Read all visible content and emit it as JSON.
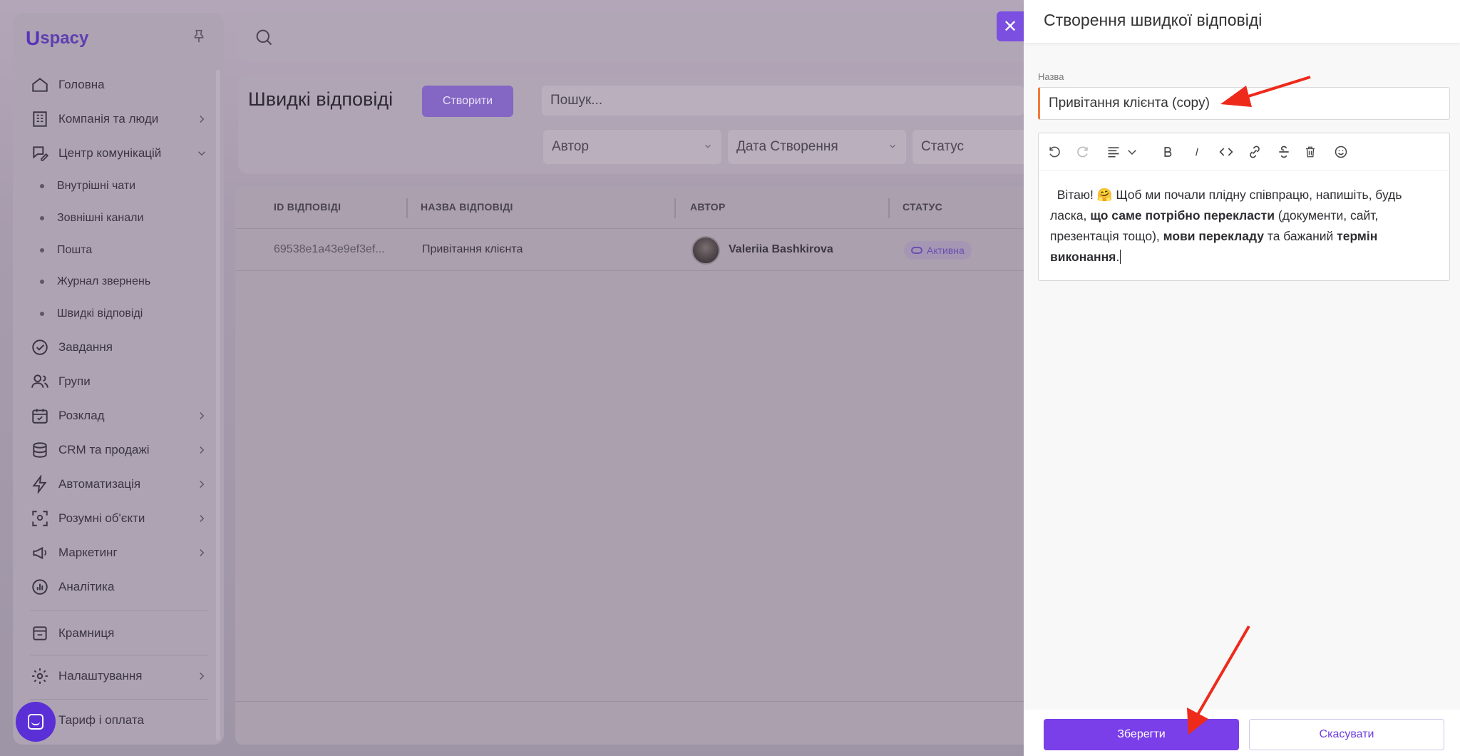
{
  "sidebar": {
    "logo": "spacy",
    "logo_u": "U",
    "items": [
      {
        "label": "Головна"
      },
      {
        "label": "Компанія та люди"
      },
      {
        "label": "Центр комунікацій"
      },
      {
        "label": "Завдання"
      },
      {
        "label": "Групи"
      },
      {
        "label": "Розклад"
      },
      {
        "label": "CRM та продажі"
      },
      {
        "label": "Автоматизація"
      },
      {
        "label": "Розумні об'єкти"
      },
      {
        "label": "Маркетинг"
      },
      {
        "label": "Аналітика"
      },
      {
        "label": "Крамниця"
      },
      {
        "label": "Налаштування"
      },
      {
        "label": "Тариф і оплата"
      }
    ],
    "sub_items": [
      {
        "label": "Внутрішні чати"
      },
      {
        "label": "Зовнішні канали"
      },
      {
        "label": "Пошта"
      },
      {
        "label": "Журнал звернень"
      },
      {
        "label": "Швидкі відповіді"
      }
    ]
  },
  "page": {
    "title": "Швидкі відповіді",
    "create_label": "Створити",
    "search_placeholder": "Пошук...",
    "filters": {
      "author": "Автор",
      "date": "Дата Створення",
      "status": "Статус"
    }
  },
  "table": {
    "headers": [
      "ID ВІДПОВІДІ",
      "НАЗВА ВІДПОВІДІ",
      "АВТОР",
      "СТАТУС"
    ],
    "rows": [
      {
        "id": "69538e1a43e9ef3ef...",
        "name": "Привітання клієнта",
        "author": "Valeriia Bashkirova",
        "status": "Активна"
      }
    ]
  },
  "drawer": {
    "title": "Створення швидкої відповіді",
    "name_label": "Назва",
    "name_value": "Привітання клієнта (copy)",
    "editor": {
      "t1": "Вітаю! ",
      "emoji": "🤗",
      "t2": " Щоб ми почали плідну співпрацю, напишіть, будь ласка, ",
      "b1": "що саме потрібно перекласти",
      "t3": " (документи, сайт, презентація тощо), ",
      "b2": "мови перекладу",
      "t4": " та бажаний ",
      "b3": "термін виконання",
      "t5": "."
    },
    "save_label": "Зберегти",
    "cancel_label": "Скасувати",
    "close_glyph": "✕"
  },
  "colors": {
    "accent": "#7a3fe8",
    "input_accent": "#f27a3c",
    "arrow": "#ee2a1b"
  }
}
